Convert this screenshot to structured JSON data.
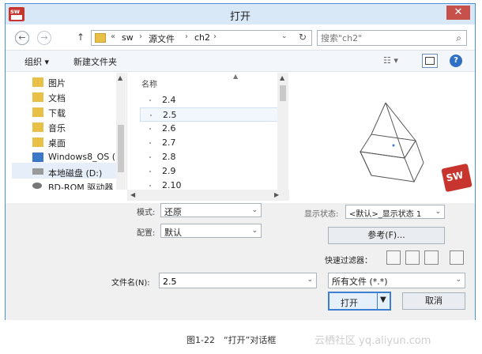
{
  "window": {
    "title": "打开",
    "close_glyph": "✕"
  },
  "address_bar": {
    "back_glyph": "←",
    "forward_glyph": "→",
    "up_glyph": "↑",
    "overflow": "«",
    "crumbs": [
      "sw",
      "源文件",
      "ch2"
    ],
    "separator": "›",
    "dropdown_glyph": "⌄",
    "refresh_glyph": "↻",
    "search_placeholder": "搜索\"ch2\"",
    "search_glyph": "⌕"
  },
  "toolbar": {
    "organize": "组织 ▾",
    "new_folder": "新建文件夹",
    "view_glyph": "☷ ▾",
    "help_glyph": "?"
  },
  "nav_pane": {
    "items": [
      {
        "label": "图片",
        "icon": "pictures-icon",
        "color": "#e8c048"
      },
      {
        "label": "文档",
        "icon": "documents-icon",
        "color": "#e8c048"
      },
      {
        "label": "下载",
        "icon": "downloads-icon",
        "color": "#e8c048"
      },
      {
        "label": "音乐",
        "icon": "music-icon",
        "color": "#e8c048"
      },
      {
        "label": "桌面",
        "icon": "desktop-icon",
        "color": "#e8c048"
      },
      {
        "label": "Windows8_OS (",
        "icon": "windows-drive-icon",
        "color": "#3a78c8"
      },
      {
        "label": "本地磁盘 (D:)",
        "icon": "hard-drive-icon",
        "color": "#9a9a9a"
      },
      {
        "label": "BD-ROM 驱动器",
        "icon": "optical-drive-icon",
        "color": "#777777"
      }
    ],
    "selected_index": 6
  },
  "file_list": {
    "column_name": "名称",
    "files": [
      "2.4",
      "2.5",
      "2.6",
      "2.7",
      "2.8",
      "2.9",
      "2.10"
    ],
    "selected_index": 1
  },
  "options": {
    "mode_label": "模式:",
    "mode_value": "还原",
    "config_label": "配置:",
    "config_value": "默认",
    "display_state_label": "显示状态:",
    "display_state_value": "<默认>_显示状态 1",
    "references_button": "参考(F)...",
    "quick_filter_label": "快速过滤器：",
    "filename_label": "文件名(N):",
    "filename_value": "2.5",
    "filetype_value": "所有文件 (*.*)",
    "open_button": "打开",
    "cancel_button": "取消"
  },
  "caption": {
    "text": "图1-22　“打开”对话框",
    "watermark": "云栖社区 yq.aliyun.com"
  },
  "colors": {
    "accent": "#3c7fd0",
    "logo_red": "#c8352e",
    "close_red": "#c7504a"
  }
}
